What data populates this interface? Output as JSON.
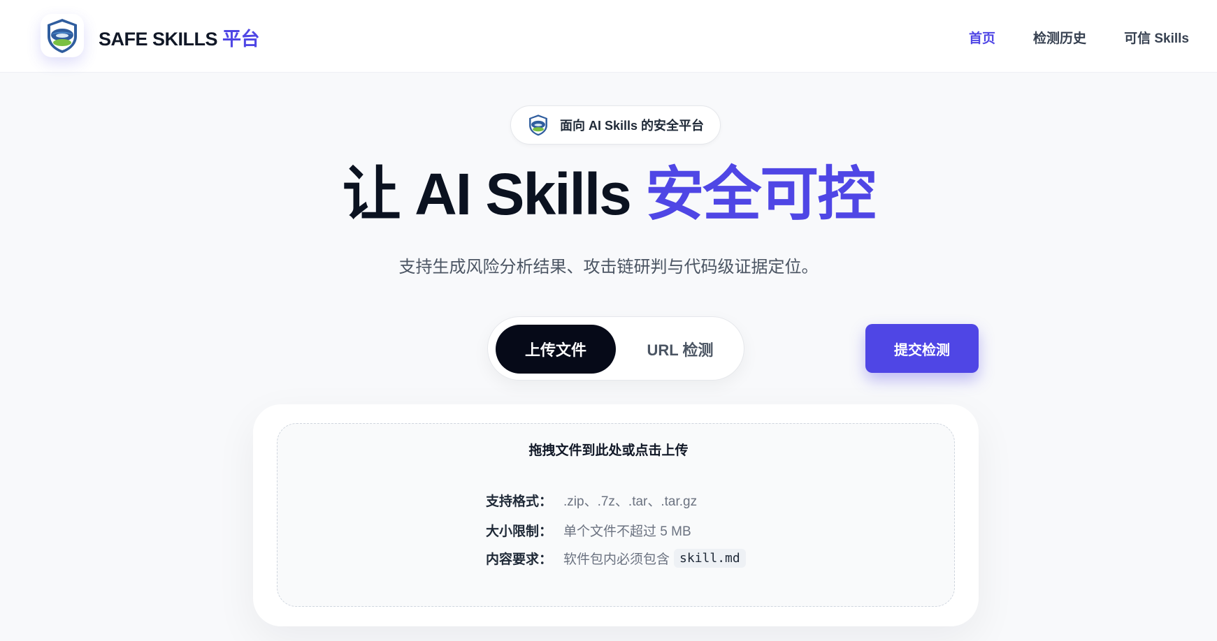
{
  "header": {
    "brand_main": "SAFE SKILLS",
    "brand_accent": "平台",
    "nav": [
      {
        "label": "首页",
        "active": true
      },
      {
        "label": "检测历史",
        "active": false
      },
      {
        "label": "可信 Skills",
        "active": false
      }
    ]
  },
  "hero": {
    "pill_text": "面向 AI Skills 的安全平台",
    "title_main": "让 AI Skills ",
    "title_accent": "安全可控",
    "subtitle": "支持生成风险分析结果、攻击链研判与代码级证据定位。"
  },
  "mode_tabs": [
    {
      "label": "上传文件",
      "active": true
    },
    {
      "label": "URL 检测",
      "active": false
    }
  ],
  "submit_label": "提交检测",
  "upload": {
    "title": "拖拽文件到此处或点击上传",
    "rows": [
      {
        "key": "支持格式：",
        "value": ".zip、.7z、.tar、.tar.gz"
      },
      {
        "key": "大小限制：",
        "value": "单个文件不超过 5 MB"
      },
      {
        "key": "内容要求：",
        "value": "软件包内必须包含",
        "code": "skill.md"
      }
    ]
  },
  "colors": {
    "accent": "#4f46e5",
    "dark": "#060a18",
    "background": "#f8f9fb"
  },
  "icons": {
    "logo": "shield-logo-icon",
    "pill": "shield-logo-icon"
  }
}
